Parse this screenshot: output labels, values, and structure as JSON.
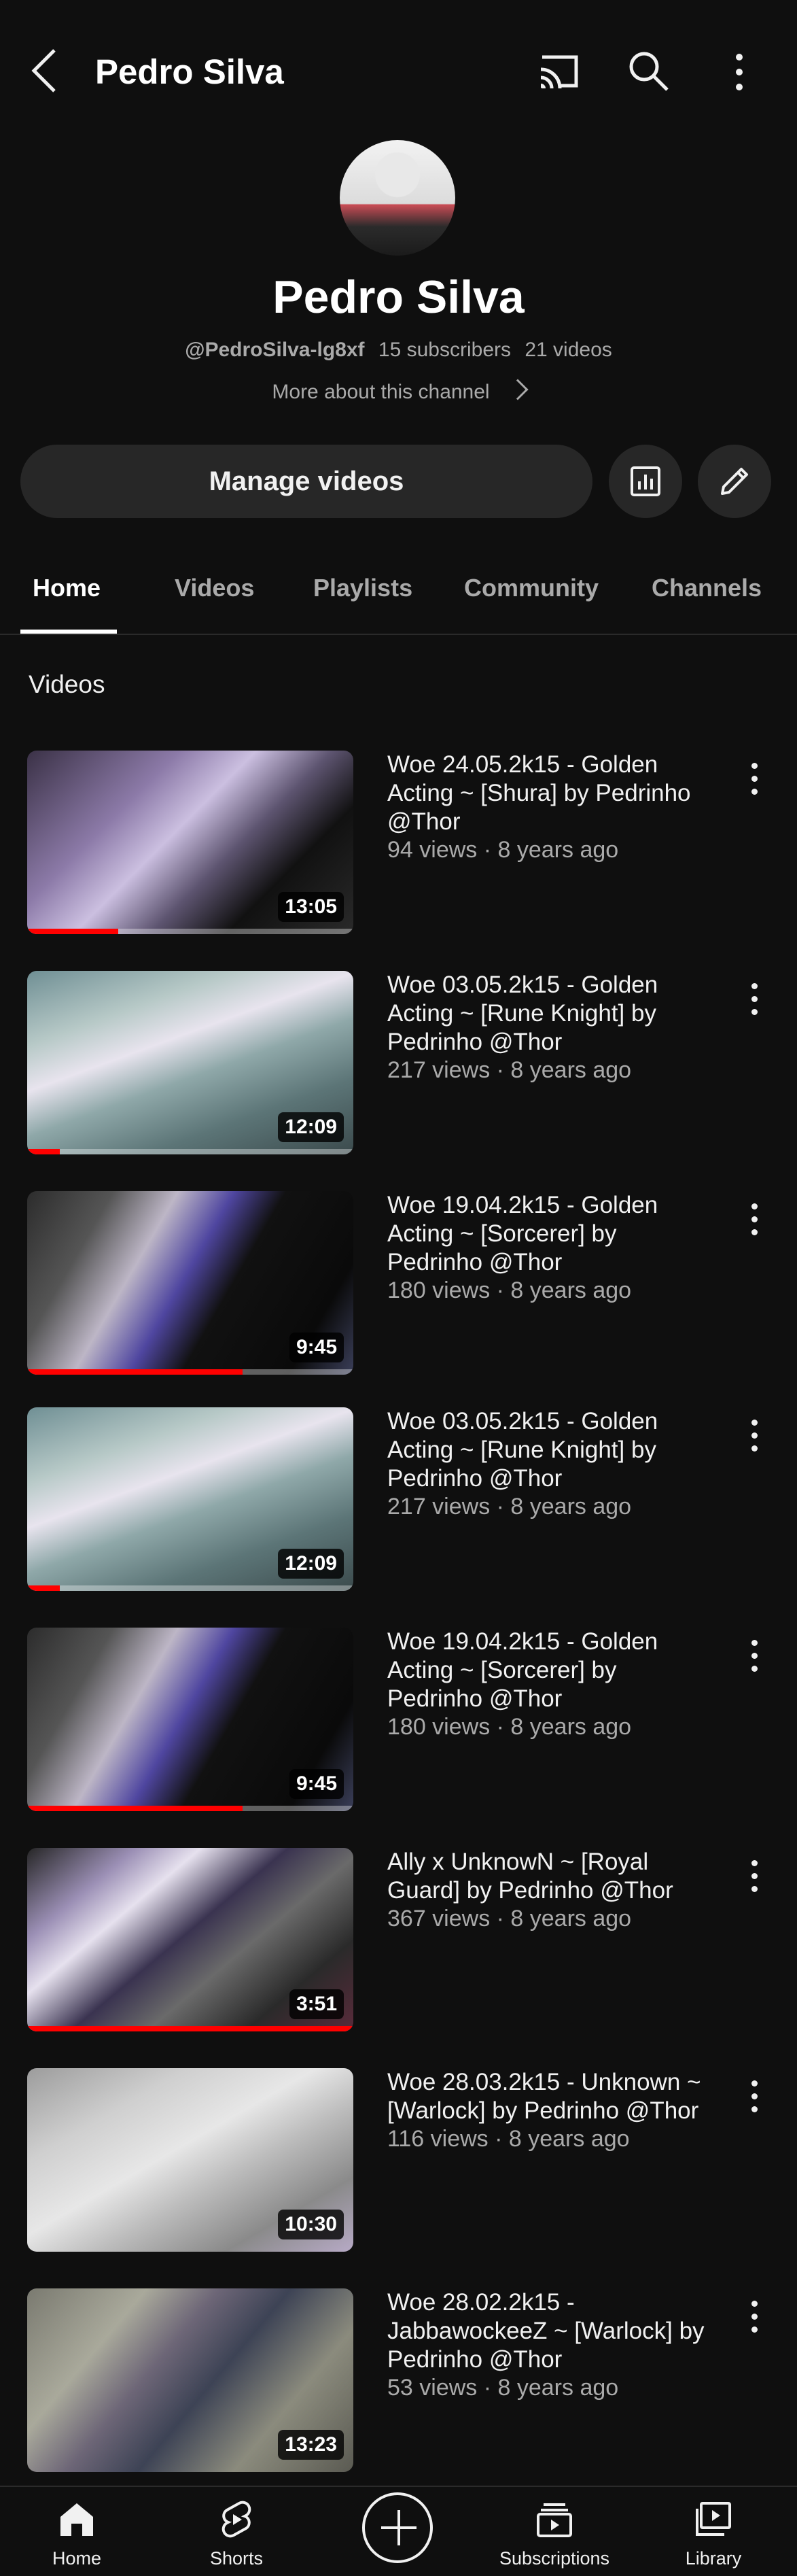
{
  "header": {
    "title": "Pedro Silva",
    "icons": [
      "back-icon",
      "cast-icon",
      "search-icon",
      "more-vert-icon"
    ]
  },
  "channel": {
    "name": "Pedro Silva",
    "handle": "@PedroSilva-lg8xf",
    "subscribers": "15 subscribers",
    "videos": "21 videos",
    "about": "More about this channel"
  },
  "actions": {
    "manage_label": "Manage videos",
    "icons": [
      "analytics-icon",
      "pencil-icon"
    ]
  },
  "tabs": [
    {
      "label": "Home",
      "active": true
    },
    {
      "label": "Videos"
    },
    {
      "label": "Playlists"
    },
    {
      "label": "Community"
    },
    {
      "label": "Channels"
    }
  ],
  "section_title": "Videos",
  "videos": [
    {
      "title": "Woe 24.05.2k15 - Golden Acting ~ [Shura] by Pedrinho @Thor",
      "meta": "94 views · 8 years ago",
      "duration": "13:05",
      "progress": 0.28
    },
    {
      "title": "Woe 03.05.2k15 - Golden Acting ~ [Rune Knight] by Pedrinho @Thor",
      "meta": "217 views · 8 years ago",
      "duration": "12:09",
      "progress": 0.1
    },
    {
      "title": "Woe 19.04.2k15 - Golden Acting ~ [Sorcerer] by Pedrinho @Thor",
      "meta": "180 views · 8 years ago",
      "duration": "9:45",
      "progress": 0.66
    },
    {
      "title": "Woe 03.05.2k15 - Golden Acting ~ [Rune Knight] by Pedrinho @Thor",
      "meta": "217 views · 8 years ago",
      "duration": "12:09",
      "progress": 0.1
    },
    {
      "title": "Woe 19.04.2k15 - Golden Acting ~ [Sorcerer] by Pedrinho @Thor",
      "meta": "180 views · 8 years ago",
      "duration": "9:45",
      "progress": 0.66
    },
    {
      "title": "Ally x UnknowN ~ [Royal Guard] by Pedrinho @Thor",
      "meta": "367 views · 8 years ago",
      "duration": "3:51",
      "progress": 1.0
    },
    {
      "title": "Woe 28.03.2k15 - Unknown ~ [Warlock] by Pedrinho @Thor",
      "meta": "116 views · 8 years ago",
      "duration": "10:30",
      "progress": 0.0
    },
    {
      "title": "Woe 28.02.2k15 - JabbawockeeZ ~ [Warlock] by Pedrinho @Thor",
      "meta": "53 views · 8 years ago",
      "duration": "13:23",
      "progress": 0.0
    }
  ],
  "bottom_nav": [
    {
      "label": "Home",
      "icon": "home-icon"
    },
    {
      "label": "Shorts",
      "icon": "shorts-icon"
    },
    {
      "label": "",
      "icon": "create-icon"
    },
    {
      "label": "Subscriptions",
      "icon": "subscriptions-icon"
    },
    {
      "label": "Library",
      "icon": "library-icon"
    }
  ]
}
